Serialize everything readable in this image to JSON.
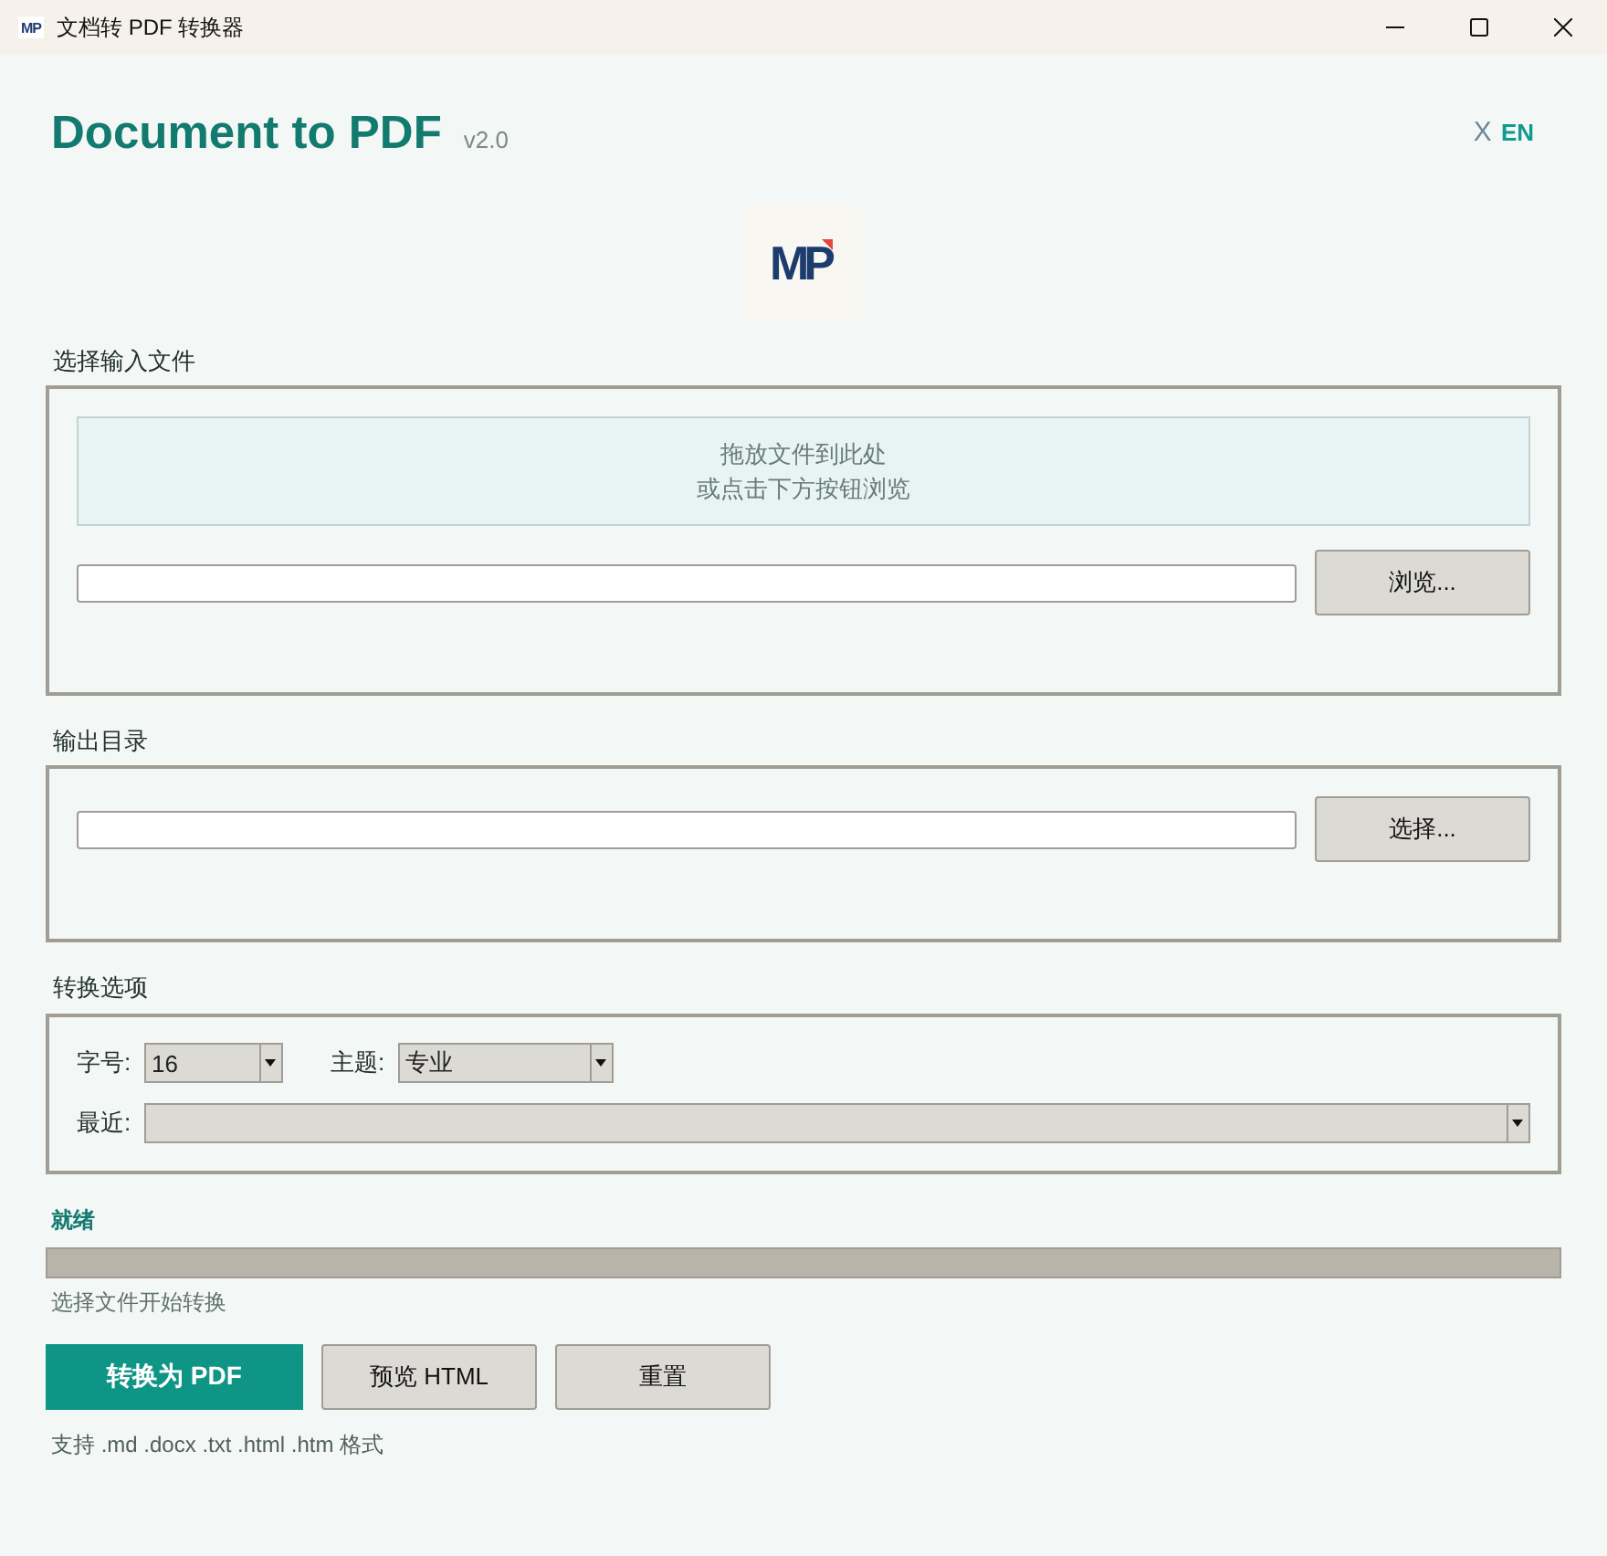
{
  "window": {
    "icon_text": "MP",
    "title": "文档转 PDF 转换器"
  },
  "header": {
    "title": "Document to PDF",
    "version": "v2.0",
    "language": {
      "mark": "X",
      "label": "EN"
    },
    "logo_text": "MP"
  },
  "input_section": {
    "label": "选择输入文件",
    "drop_zone": [
      "拖放文件到此处",
      "或点击下方按钮浏览"
    ],
    "button": "浏览..."
  },
  "output_section": {
    "label": "输出目录",
    "button": "选择..."
  },
  "options": {
    "label": "转换选项",
    "rows": [
      [
        {
          "label": "字号:",
          "value": "16"
        },
        {
          "label": "主题:",
          "value": "专业"
        }
      ],
      [
        {
          "label": "最近:"
        }
      ]
    ]
  },
  "status": {
    "text": "就绪",
    "level": 0,
    "message": "选择文件开始转换"
  },
  "buttons": [
    {
      "label": "转换为 PDF",
      "kind": "primary"
    },
    {
      "label": "预览 HTML",
      "kind": "secondary"
    },
    {
      "label": "重置",
      "kind": "secondary"
    }
  ],
  "footer_note": "支持 .md .docx .txt .html .htm 格式"
}
